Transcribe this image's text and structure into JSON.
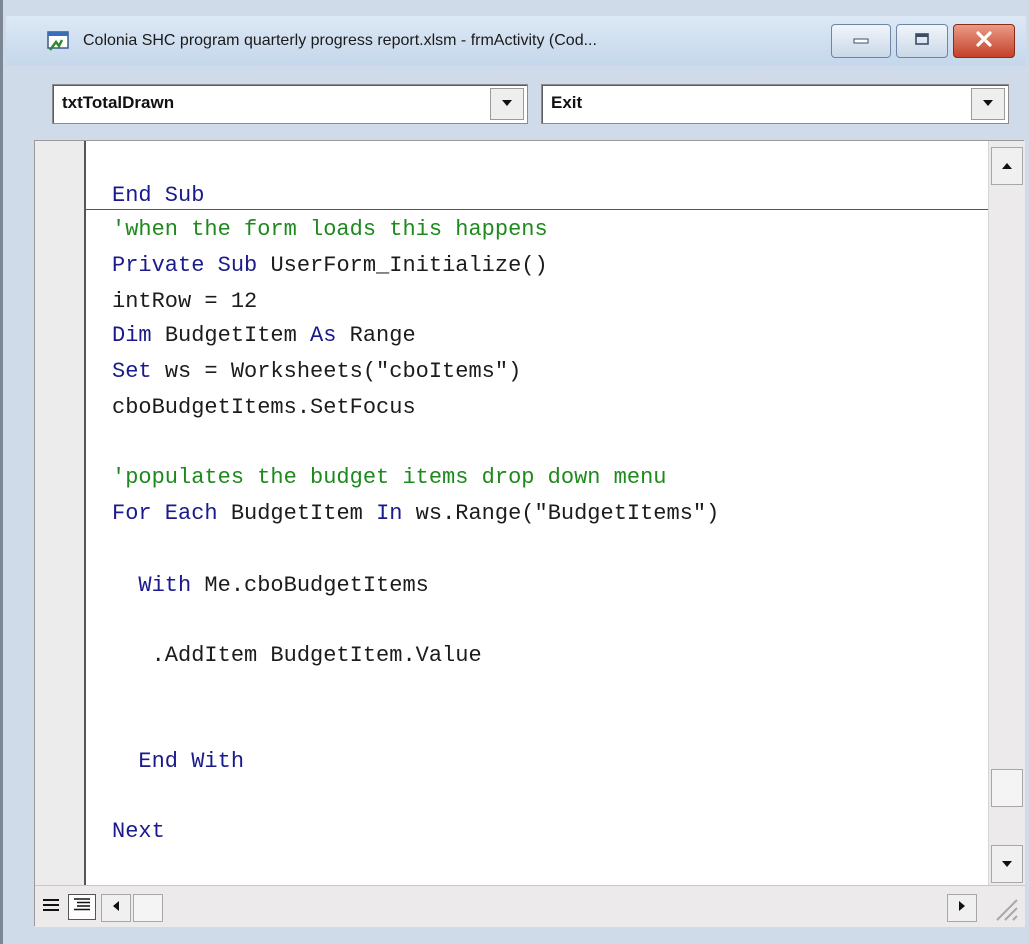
{
  "window": {
    "title": "Colonia SHC program quarterly progress report.xlsm - frmActivity (Cod..."
  },
  "object_combo": {
    "value": "txtTotalDrawn"
  },
  "procedure_combo": {
    "value": "Exit"
  },
  "code_lines": [
    {
      "segments": [
        {
          "text": "End Sub",
          "kind": "kw"
        }
      ]
    },
    {
      "segments": [
        {
          "text": "'when the form loads this happens",
          "kind": "cm"
        }
      ]
    },
    {
      "segments": [
        {
          "text": "Private Sub ",
          "kind": "kw"
        },
        {
          "text": "UserForm_Initialize()",
          "kind": "tx"
        }
      ]
    },
    {
      "segments": [
        {
          "text": "intRow = 12",
          "kind": "tx"
        }
      ]
    },
    {
      "segments": [
        {
          "text": "Dim ",
          "kind": "kw"
        },
        {
          "text": "BudgetItem ",
          "kind": "tx"
        },
        {
          "text": "As ",
          "kind": "kw"
        },
        {
          "text": "Range",
          "kind": "tx"
        }
      ]
    },
    {
      "segments": [
        {
          "text": "Set ",
          "kind": "kw"
        },
        {
          "text": "ws = Worksheets(\"cboItems\")",
          "kind": "tx"
        }
      ]
    },
    {
      "segments": [
        {
          "text": "cboBudgetItems.SetFocus",
          "kind": "tx"
        }
      ]
    },
    {
      "segments": [
        {
          "text": "'populates the budget items drop down menu",
          "kind": "cm"
        }
      ]
    },
    {
      "segments": [
        {
          "text": "For Each ",
          "kind": "kw"
        },
        {
          "text": "BudgetItem ",
          "kind": "tx"
        },
        {
          "text": "In ",
          "kind": "kw"
        },
        {
          "text": "ws.Range(\"BudgetItems\")",
          "kind": "tx"
        }
      ]
    },
    {
      "segments": [
        {
          "text": "  With ",
          "kind": "kw"
        },
        {
          "text": "Me.cboBudgetItems",
          "kind": "tx"
        }
      ]
    },
    {
      "segments": [
        {
          "text": "   .AddItem BudgetItem.Value",
          "kind": "tx"
        }
      ]
    },
    {
      "segments": [
        {
          "text": "  End With",
          "kind": "kw"
        }
      ]
    },
    {
      "segments": [
        {
          "text": "Next",
          "kind": "kw"
        }
      ]
    }
  ],
  "colors": {
    "keyword": "#1a1a8c",
    "comment": "#1e8a1e",
    "text": "#1c1c1c"
  },
  "icons": {
    "app": "vba-project-icon",
    "minimize": "minimize-icon",
    "maximize": "maximize-icon",
    "close": "close-icon",
    "dropdown": "chevron-down-icon",
    "procedure_view": "procedure-view-icon",
    "full_module_view": "full-module-view-icon"
  }
}
